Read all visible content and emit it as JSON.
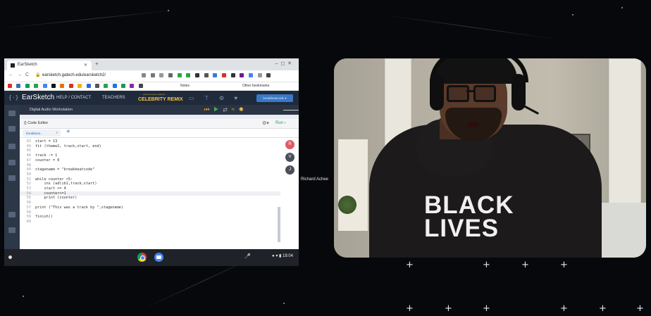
{
  "browser": {
    "tab_title": "EarSketch",
    "url": "earsketch.gatech.edu/earsketch2/",
    "bookmarks_notes": "Notes",
    "bookmarks_other": "Other bookmarks"
  },
  "earsketch": {
    "logo": "{·}",
    "title": "EarSketch",
    "nav_help": "HELP / CONTACT",
    "nav_teachers": "TEACHERS",
    "remix_sub": "amazon future engineer",
    "remix_label": "CELEBRITY REMIX",
    "user_button": "breakbeatcode ▾",
    "daw_label": "Digital Audio Workstation",
    "code_editor_label": "Code Editor",
    "run_label": "Run",
    "file_tab": "breakbeat...",
    "collaborators": [
      {
        "initial": "R",
        "color": "#e05a63"
      },
      {
        "initial": "V",
        "color": "#4b4f57"
      },
      {
        "initial": "J",
        "color": "#4b4f57"
      }
    ],
    "code_lines": [
      {
        "n": "43",
        "t": "start = 13"
      },
      {
        "n": "44",
        "t": "fit (theme2, track,start, end)"
      },
      {
        "n": "45",
        "t": ""
      },
      {
        "n": "46",
        "t": "track -= 1"
      },
      {
        "n": "47",
        "t": "counter = 0"
      },
      {
        "n": "48",
        "t": ""
      },
      {
        "n": "49",
        "t": "stagename = \"breakbeatcode\""
      },
      {
        "n": "50",
        "t": ""
      },
      {
        "n": "51",
        "t": "while counter <5:"
      },
      {
        "n": "52",
        "t": "    ins (adlib1,track,start)"
      },
      {
        "n": "53",
        "t": "    start += 4"
      },
      {
        "n": "54",
        "t": "    counter+=1"
      },
      {
        "n": "55",
        "t": "    print (counter)"
      },
      {
        "n": "56",
        "t": ""
      },
      {
        "n": "57",
        "t": "print (\"This was a track by \",stagename)"
      },
      {
        "n": "58",
        "t": ""
      },
      {
        "n": "59",
        "t": "finish()"
      },
      {
        "n": "60",
        "t": ""
      }
    ]
  },
  "taskbar": {
    "time": "18:04"
  },
  "meeting": {
    "presenter_name": "Richard Achee",
    "shirt_line1": "BLACK",
    "shirt_line2": "LIVES"
  }
}
